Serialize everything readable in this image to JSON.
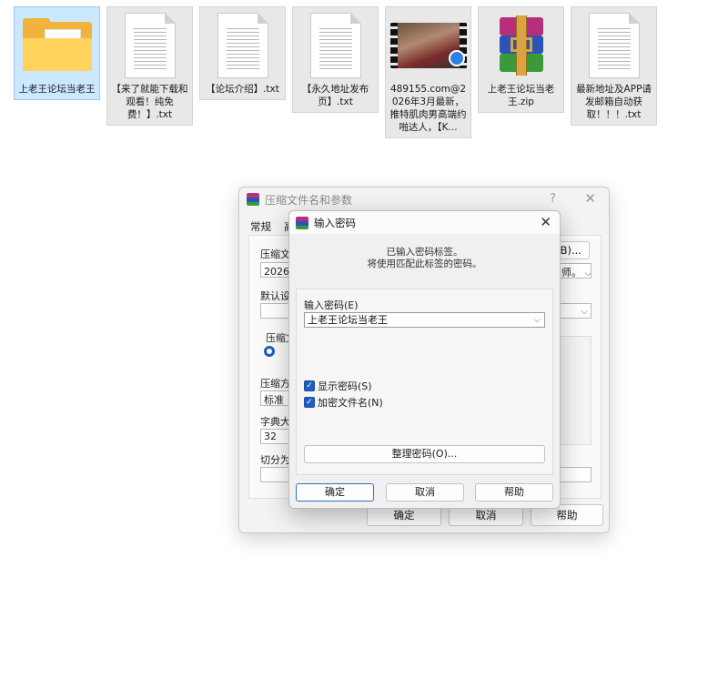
{
  "desktop": {
    "files": [
      {
        "name": "上老王论坛当老王",
        "type": "folder",
        "selected": true
      },
      {
        "name": "【来了就能下载和观看！纯免费！】.txt",
        "type": "txt"
      },
      {
        "name": "【论坛介绍】.txt",
        "type": "txt"
      },
      {
        "name": "【永久地址发布页】.txt",
        "type": "txt"
      },
      {
        "name": "489155.com@2026年3月最新，推特肌肉男高端约啪达人，【K...",
        "type": "video"
      },
      {
        "name": "上老王论坛当老王.zip",
        "type": "rar"
      },
      {
        "name": "最新地址及APP请发邮箱自动获取！！！.txt",
        "type": "txt"
      }
    ]
  },
  "archive_dialog": {
    "title": "压缩文件名和参数",
    "help_glyph": "?",
    "close_glyph": "✕",
    "tabs": [
      "常规",
      "高"
    ],
    "archive_name_label": "压缩文",
    "archive_name_value": "2026年",
    "browse_button": "(B)...",
    "profile_value": "步师。",
    "default_settings_label": "默认设",
    "format_label": "压缩文",
    "method_label": "压缩方",
    "method_value": "标准",
    "dict_label": "字典大",
    "dict_value": "32",
    "split_label": "切分为",
    "ok_button": "确定",
    "cancel_button": "取消",
    "help_button": "帮助"
  },
  "password_dialog": {
    "title": "输入密码",
    "close_glyph": "✕",
    "info_line1": "已输入密码标签。",
    "info_line2": "将使用匹配此标签的密码。",
    "password_label": "输入密码(E)",
    "password_value": "上老王论坛当老王",
    "show_password_label": "显示密码(S)",
    "show_password_checked": true,
    "encrypt_filenames_label": "加密文件名(N)",
    "encrypt_filenames_checked": true,
    "manage_button": "整理密码(O)...",
    "ok_button": "确定",
    "cancel_button": "取消",
    "help_button": "帮助"
  }
}
